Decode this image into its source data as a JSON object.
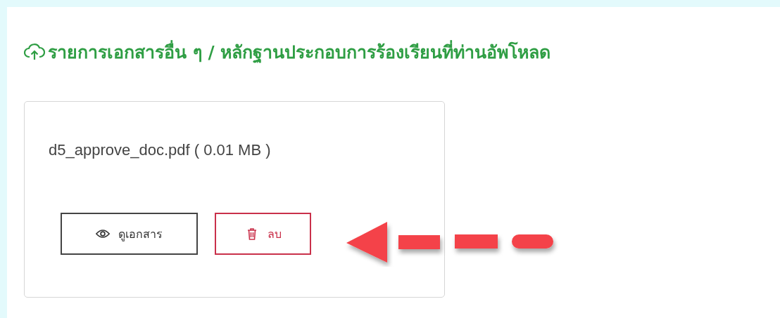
{
  "section": {
    "title": "รายการเอกสารอื่น ๆ / หลักฐานประกอบการร้องเรียนที่ท่านอัพโหลด"
  },
  "files": [
    {
      "name": "d5_approve_doc.pdf ( 0.01 MB )",
      "buttons": [
        {
          "kind": "view",
          "label": "ดูเอกสาร"
        },
        {
          "kind": "delete",
          "label": "ลบ"
        }
      ]
    }
  ]
}
